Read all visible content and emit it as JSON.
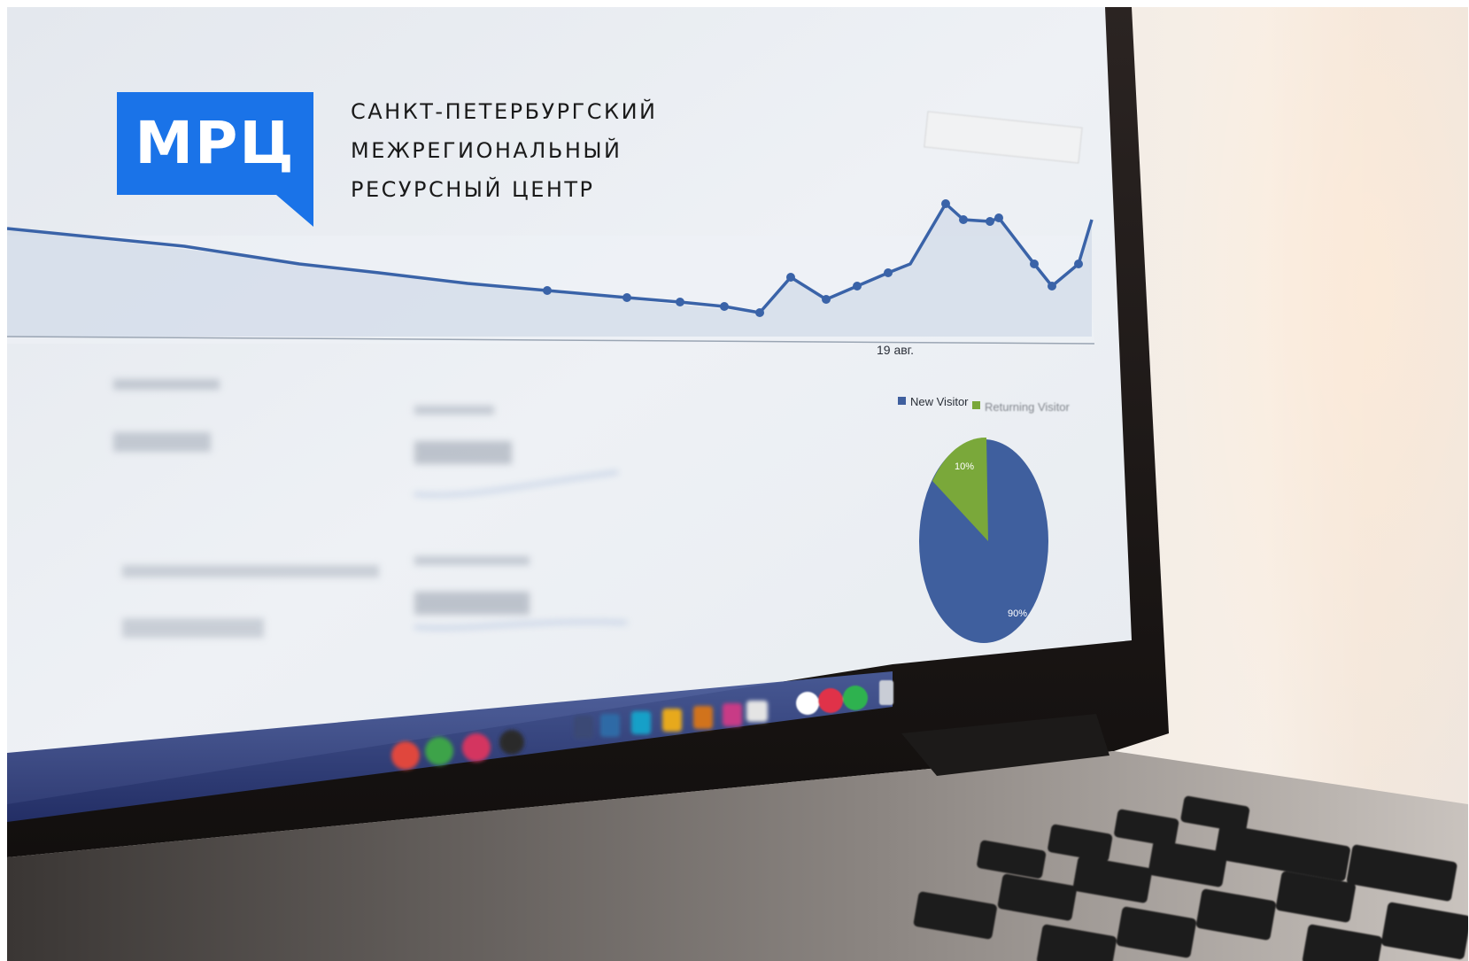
{
  "brand": {
    "logo_text": "МРЦ",
    "name_lines": [
      "САНКТ-ПЕТЕРБУРГСКИЙ",
      "МЕЖРЕГИОНАЛЬНЫЙ",
      "РЕСУРСНЫЙ ЦЕНТР"
    ],
    "accent_color": "#1a73e8"
  },
  "screen": {
    "date_label": "19 авг.",
    "legend": [
      "New Visitor",
      "Returning Visitor"
    ],
    "pie_labels": [
      "10%",
      "90%"
    ],
    "colors": {
      "new": "#3f5f9e",
      "returning": "#7aa83a"
    }
  }
}
